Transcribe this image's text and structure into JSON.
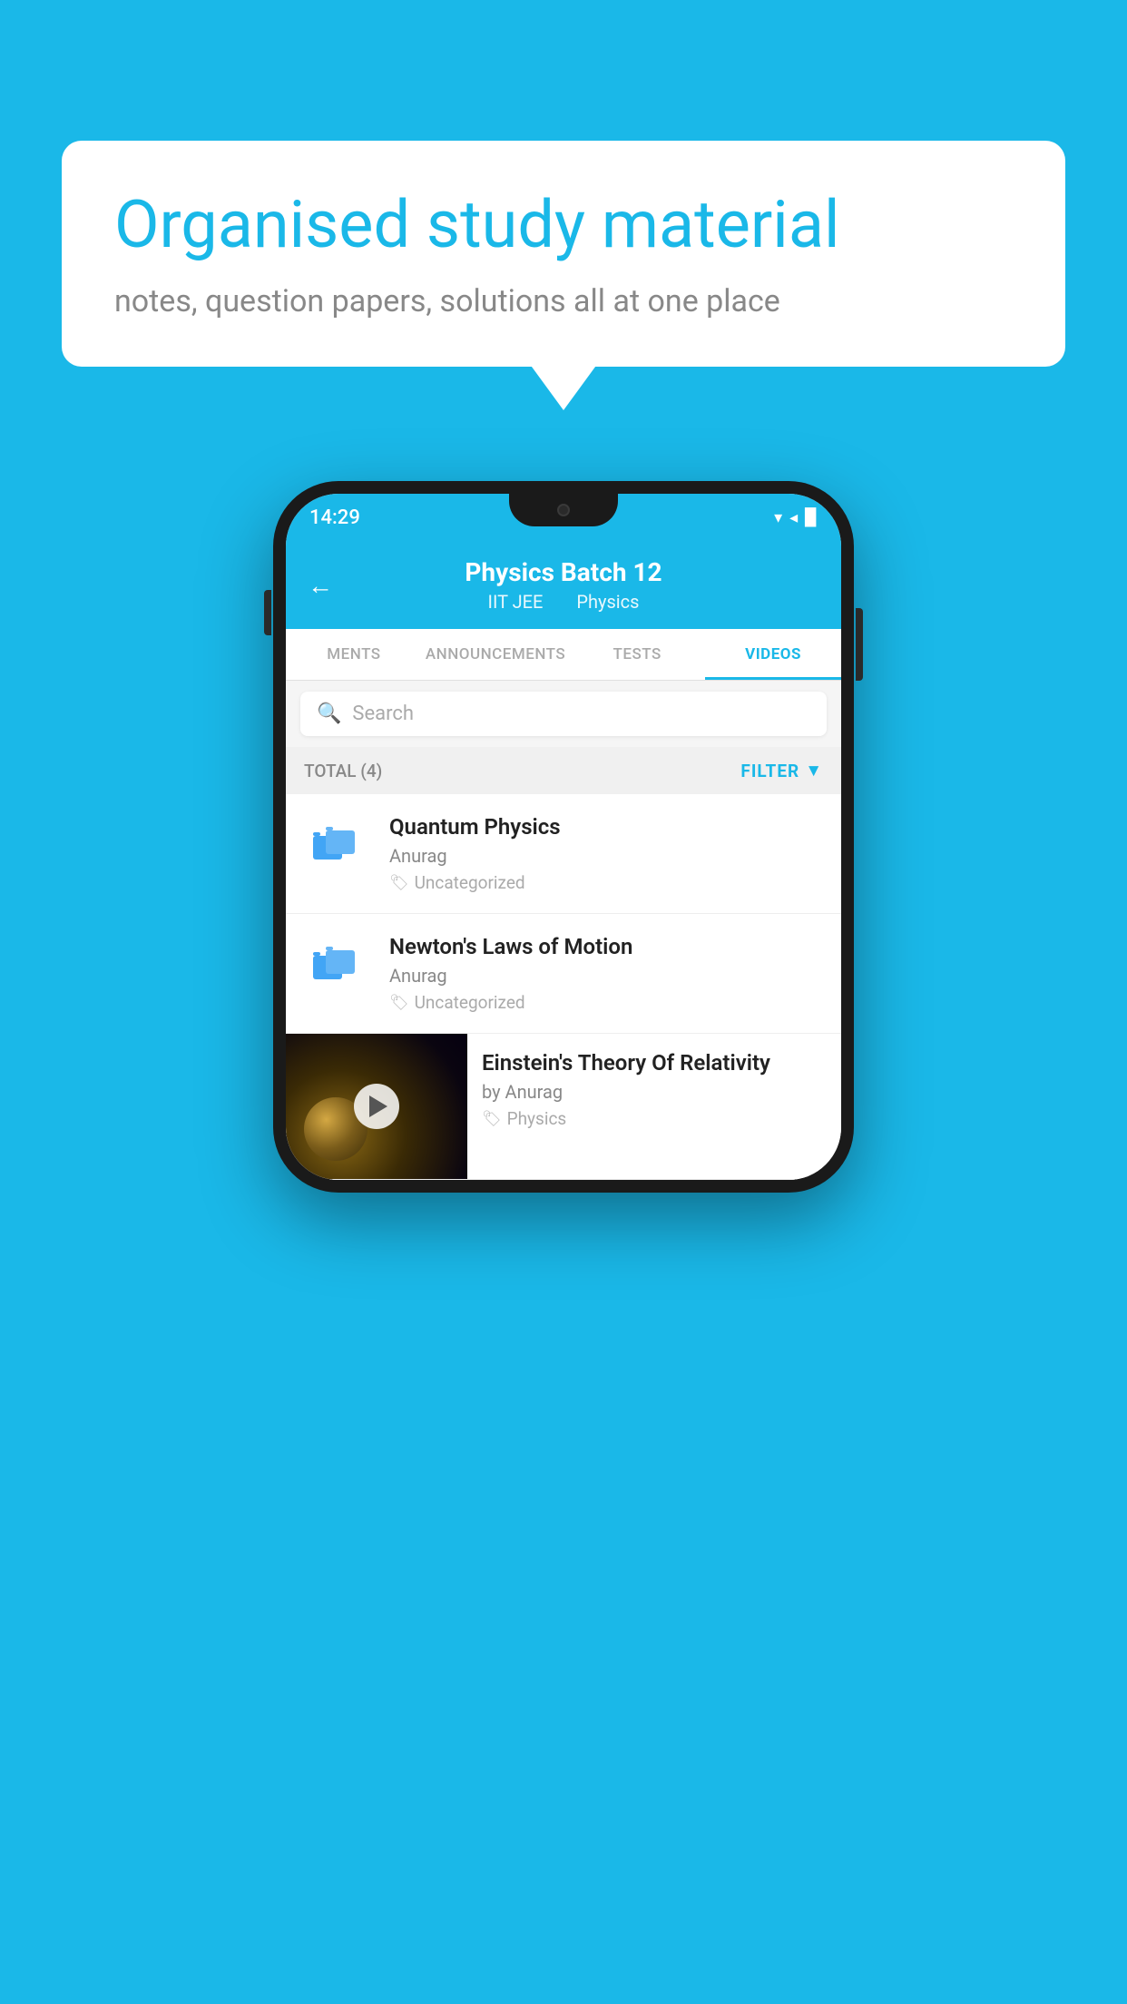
{
  "background_color": "#1ab8e8",
  "speech_bubble": {
    "title": "Organised study material",
    "subtitle": "notes, question papers, solutions all at one place"
  },
  "phone": {
    "status_bar": {
      "time": "14:29",
      "icons": "▾◂▉"
    },
    "header": {
      "title": "Physics Batch 12",
      "subtitle_part1": "IIT JEE",
      "subtitle_part2": "Physics",
      "back_label": "←"
    },
    "tabs": [
      {
        "label": "MENTS",
        "active": false
      },
      {
        "label": "ANNOUNCEMENTS",
        "active": false
      },
      {
        "label": "TESTS",
        "active": false
      },
      {
        "label": "VIDEOS",
        "active": true
      }
    ],
    "search": {
      "placeholder": "Search"
    },
    "filter_bar": {
      "total_label": "TOTAL (4)",
      "filter_label": "FILTER"
    },
    "video_items": [
      {
        "title": "Quantum Physics",
        "author": "Anurag",
        "tag": "Uncategorized",
        "type": "folder"
      },
      {
        "title": "Newton's Laws of Motion",
        "author": "Anurag",
        "tag": "Uncategorized",
        "type": "folder"
      },
      {
        "title": "Einstein's Theory Of Relativity",
        "author": "by Anurag",
        "tag": "Physics",
        "type": "video"
      }
    ]
  }
}
